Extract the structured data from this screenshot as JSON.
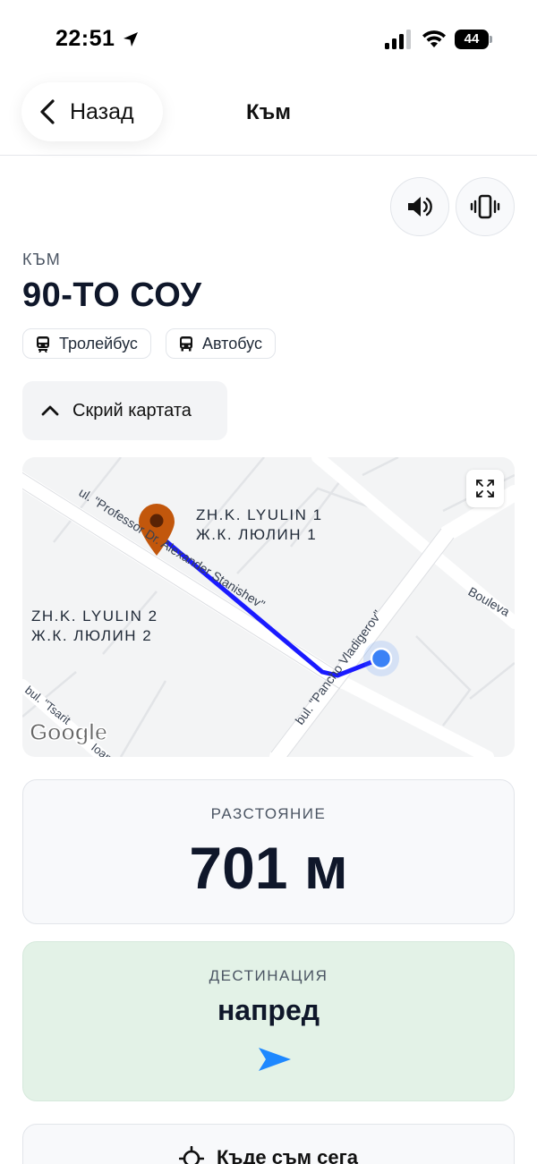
{
  "status_bar": {
    "time": "22:51",
    "battery": "44",
    "icons": [
      "location-arrow-icon",
      "cellular-signal-icon",
      "wifi-icon",
      "battery-icon"
    ]
  },
  "header": {
    "back_label": "Назад",
    "title": "Към"
  },
  "controls": {
    "sound_icon": "speaker-icon",
    "vibrate_icon": "vibrate-icon"
  },
  "destination": {
    "overline": "КЪМ",
    "name": "90-ТО СОУ",
    "transport": [
      {
        "label": "Тролейбус",
        "icon": "trolleybus-icon"
      },
      {
        "label": "Автобус",
        "icon": "bus-icon"
      }
    ]
  },
  "map_toggle": {
    "label": "Скрий картата"
  },
  "map": {
    "area_1": [
      "ZH.K. LYULIN 1",
      "Ж.К. ЛЮЛИН 1"
    ],
    "area_2": [
      "ZH.K. LYULIN 2",
      "Ж.К. ЛЮЛИН 2"
    ],
    "street_1": "ul. \"Professor Dr. Alexander Stanishev\"",
    "street_2": "bul. \"Pancho Vladigerov\"",
    "street_3": "Bouleva",
    "street_4": "bul. \"Tsarit",
    "street_5": "Ioan",
    "logo": "Google",
    "route_color": "#1a1aff",
    "pin_color": "#c2570c",
    "user_dot_color": "#3b82f6"
  },
  "distance": {
    "overline": "РАЗСТОЯНИЕ",
    "value": "701 м"
  },
  "direction": {
    "overline": "ДЕСТИНАЦИЯ",
    "value": "напред",
    "arrow_color": "#1e88ff"
  },
  "locate": {
    "label": "Къде съм сега"
  }
}
